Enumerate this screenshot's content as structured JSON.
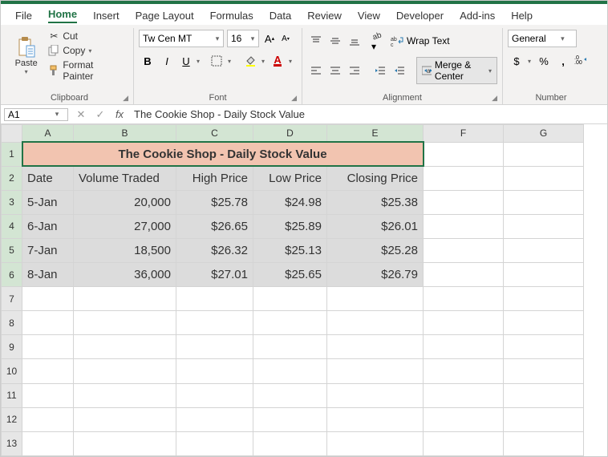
{
  "menu": {
    "items": [
      "File",
      "Home",
      "Insert",
      "Page Layout",
      "Formulas",
      "Data",
      "Review",
      "View",
      "Developer",
      "Add-ins",
      "Help"
    ],
    "active": "Home"
  },
  "ribbon": {
    "clipboard": {
      "paste": "Paste",
      "cut": "Cut",
      "copy": "Copy",
      "format_painter": "Format Painter",
      "group_label": "Clipboard"
    },
    "font": {
      "name": "Tw Cen MT",
      "size": "16",
      "inc_label": "A",
      "dec_label": "A",
      "group_label": "Font"
    },
    "alignment": {
      "wrap_text": "Wrap Text",
      "merge_center": "Merge & Center",
      "group_label": "Alignment"
    },
    "number": {
      "format": "General",
      "group_label": "Number"
    }
  },
  "formula_bar": {
    "cell_ref": "A1",
    "fx": "fx",
    "content": "The Cookie Shop - Daily Stock Value"
  },
  "columns": [
    "A",
    "B",
    "C",
    "D",
    "E",
    "F",
    "G"
  ],
  "rows": [
    "1",
    "2",
    "3",
    "4",
    "5",
    "6",
    "7",
    "8",
    "9",
    "10",
    "11",
    "12",
    "13"
  ],
  "sheet": {
    "title": "The Cookie Shop - Daily Stock Value",
    "headers": [
      "Date",
      "Volume Traded",
      "High Price",
      "Low Price",
      "Closing Price"
    ],
    "data": [
      {
        "date": "5-Jan",
        "volume": "20,000",
        "high": "$25.78",
        "low": "$24.98",
        "close": "$25.38"
      },
      {
        "date": "6-Jan",
        "volume": "27,000",
        "high": "$26.65",
        "low": "$25.89",
        "close": "$26.01"
      },
      {
        "date": "7-Jan",
        "volume": "18,500",
        "high": "$26.32",
        "low": "$25.13",
        "close": "$25.28"
      },
      {
        "date": "8-Jan",
        "volume": "36,000",
        "high": "$27.01",
        "low": "$25.65",
        "close": "$26.79"
      }
    ]
  },
  "chart_data": {
    "type": "table",
    "title": "The Cookie Shop - Daily Stock Value",
    "columns": [
      "Date",
      "Volume Traded",
      "High Price",
      "Low Price",
      "Closing Price"
    ],
    "rows": [
      [
        "5-Jan",
        20000,
        25.78,
        24.98,
        25.38
      ],
      [
        "6-Jan",
        27000,
        26.65,
        25.89,
        26.01
      ],
      [
        "7-Jan",
        18500,
        26.32,
        25.13,
        25.28
      ],
      [
        "8-Jan",
        36000,
        27.01,
        25.65,
        26.79
      ]
    ]
  }
}
